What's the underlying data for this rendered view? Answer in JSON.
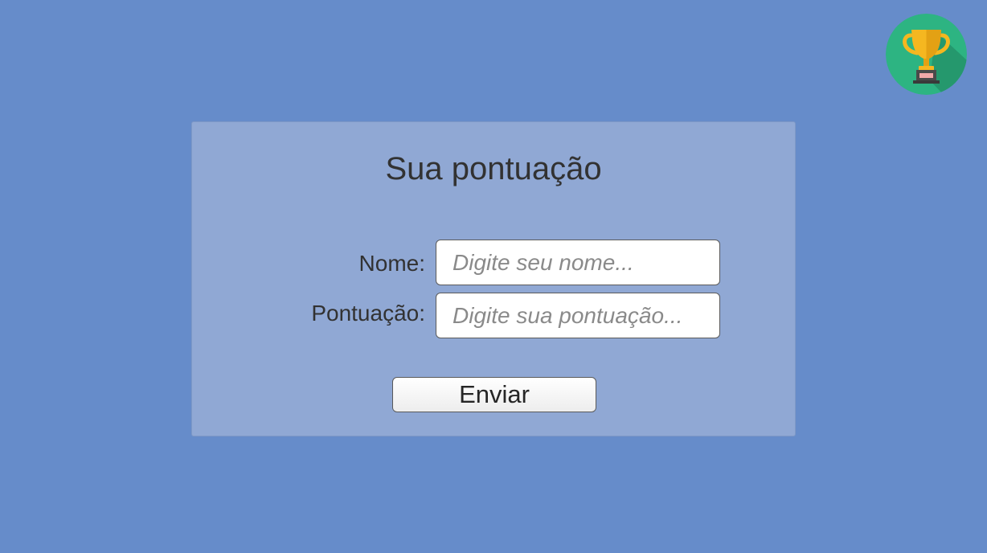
{
  "colors": {
    "background": "#668CCA",
    "panel": "#90A8D4",
    "trophy_circle": "#2DB482",
    "trophy_gold": "#F5B720",
    "text": "#323232"
  },
  "trophy_button": {
    "icon": "trophy-icon"
  },
  "form": {
    "title": "Sua pontuação",
    "name_label": "Nome:",
    "name_placeholder": "Digite seu nome...",
    "name_value": "",
    "score_label": "Pontuação:",
    "score_placeholder": "Digite sua pontuação...",
    "score_value": "",
    "submit_label": "Enviar"
  }
}
